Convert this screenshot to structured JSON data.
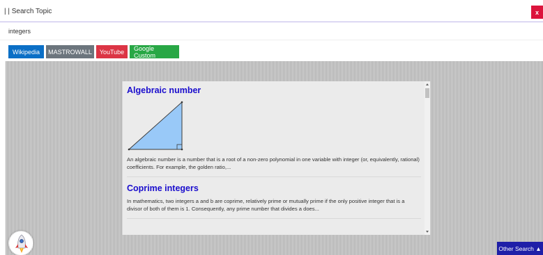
{
  "header": {
    "title": "| | Search Topic",
    "close_label": "x"
  },
  "search": {
    "value": "integers"
  },
  "engines": {
    "wikipedia": "Wikipedia",
    "mastrowall": "MASTROWALL",
    "youtube": "YouTube",
    "google": "Google Custom"
  },
  "results": [
    {
      "title": "Algebraic number",
      "snippet": "An algebraic number is a number that is a root of a non-zero polynomial in one variable with integer (or, equivalently, rational) coefficients. For example, the golden ratio,..."
    },
    {
      "title": "Coprime integers",
      "snippet": "In mathematics, two integers a and b are coprime, relatively prime or mutually prime if the only positive integer that is a divisor of both of them is 1. Consequently, any prime number that divides a does..."
    }
  ],
  "footer": {
    "other_search_label": "Other Search ▲"
  }
}
